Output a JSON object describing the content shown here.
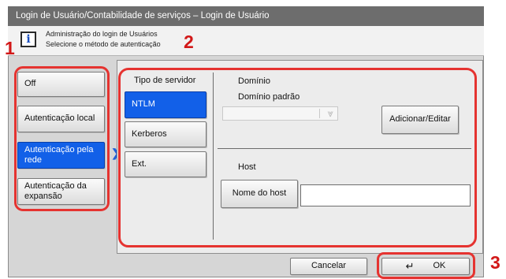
{
  "window": {
    "title": "Login de Usuário/Contabilidade de serviços – Login de Usuário"
  },
  "info": {
    "line1": "Administração do login de Usuários",
    "line2": "Selecione o método de autenticação",
    "icon": "info-icon"
  },
  "callouts": [
    "1",
    "2",
    "3"
  ],
  "auth_methods": [
    {
      "label": "Off",
      "selected": false
    },
    {
      "label": "Autenticação local",
      "selected": false
    },
    {
      "label": "Autenticação pela rede",
      "selected": true
    },
    {
      "label": "Autenticação da expansão",
      "selected": false
    }
  ],
  "server_type": {
    "label": "Tipo de servidor",
    "options": [
      {
        "label": "NTLM",
        "selected": true
      },
      {
        "label": "Kerberos",
        "selected": false
      },
      {
        "label": "Ext.",
        "selected": false
      }
    ]
  },
  "domain": {
    "label": "Domínio",
    "default_label": "Domínio padrão",
    "default_value": "",
    "add_edit_label": "Adicionar/Editar"
  },
  "host": {
    "label": "Host",
    "name_button": "Nome do host",
    "value": ""
  },
  "footer": {
    "cancel_label": "Cancelar",
    "ok_label": "OK"
  },
  "colors": {
    "selected": "#1260e8",
    "callout": "#d21818",
    "highlight": "#e53330",
    "titlebar": "#6d6d6d"
  }
}
